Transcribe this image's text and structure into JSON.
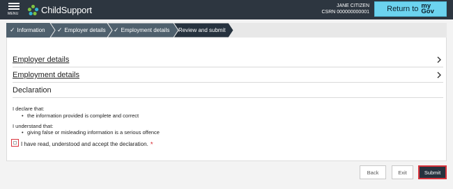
{
  "header": {
    "menu_label": "MENU",
    "app_name": "ChildSupport",
    "user_name": "JANE CITIZEN",
    "csrn": "CSRN 000000000001",
    "return_label": "Return to",
    "mygov_line1": "my",
    "mygov_line2": "Gov"
  },
  "progress": {
    "steps": [
      {
        "label": "Information",
        "completed": true
      },
      {
        "label": "Employer details",
        "completed": true
      },
      {
        "label": "Employment details",
        "completed": true
      },
      {
        "label": "Review and submit",
        "completed": false
      }
    ],
    "check_glyph": "✓"
  },
  "sections": {
    "employer_details": "Employer details",
    "employment_details": "Employment details",
    "declaration_heading": "Declaration"
  },
  "declaration": {
    "declare_intro": "I declare that:",
    "declare_item": "the information provided is complete and correct",
    "understand_intro": "I understand that:",
    "understand_item": "giving false or misleading information is a serious offence",
    "agree_label": "I have read, understood and accept the declaration.",
    "required_marker": "*",
    "agree_checked": false
  },
  "actions": {
    "back": "Back",
    "exit": "Exit",
    "submit": "Submit"
  },
  "colors": {
    "header_bg": "#2d3640",
    "step_complete": "#4f606d",
    "step_current": "#26323e",
    "mygov_accent": "#6cd3ef",
    "error_red": "#d9333c"
  }
}
